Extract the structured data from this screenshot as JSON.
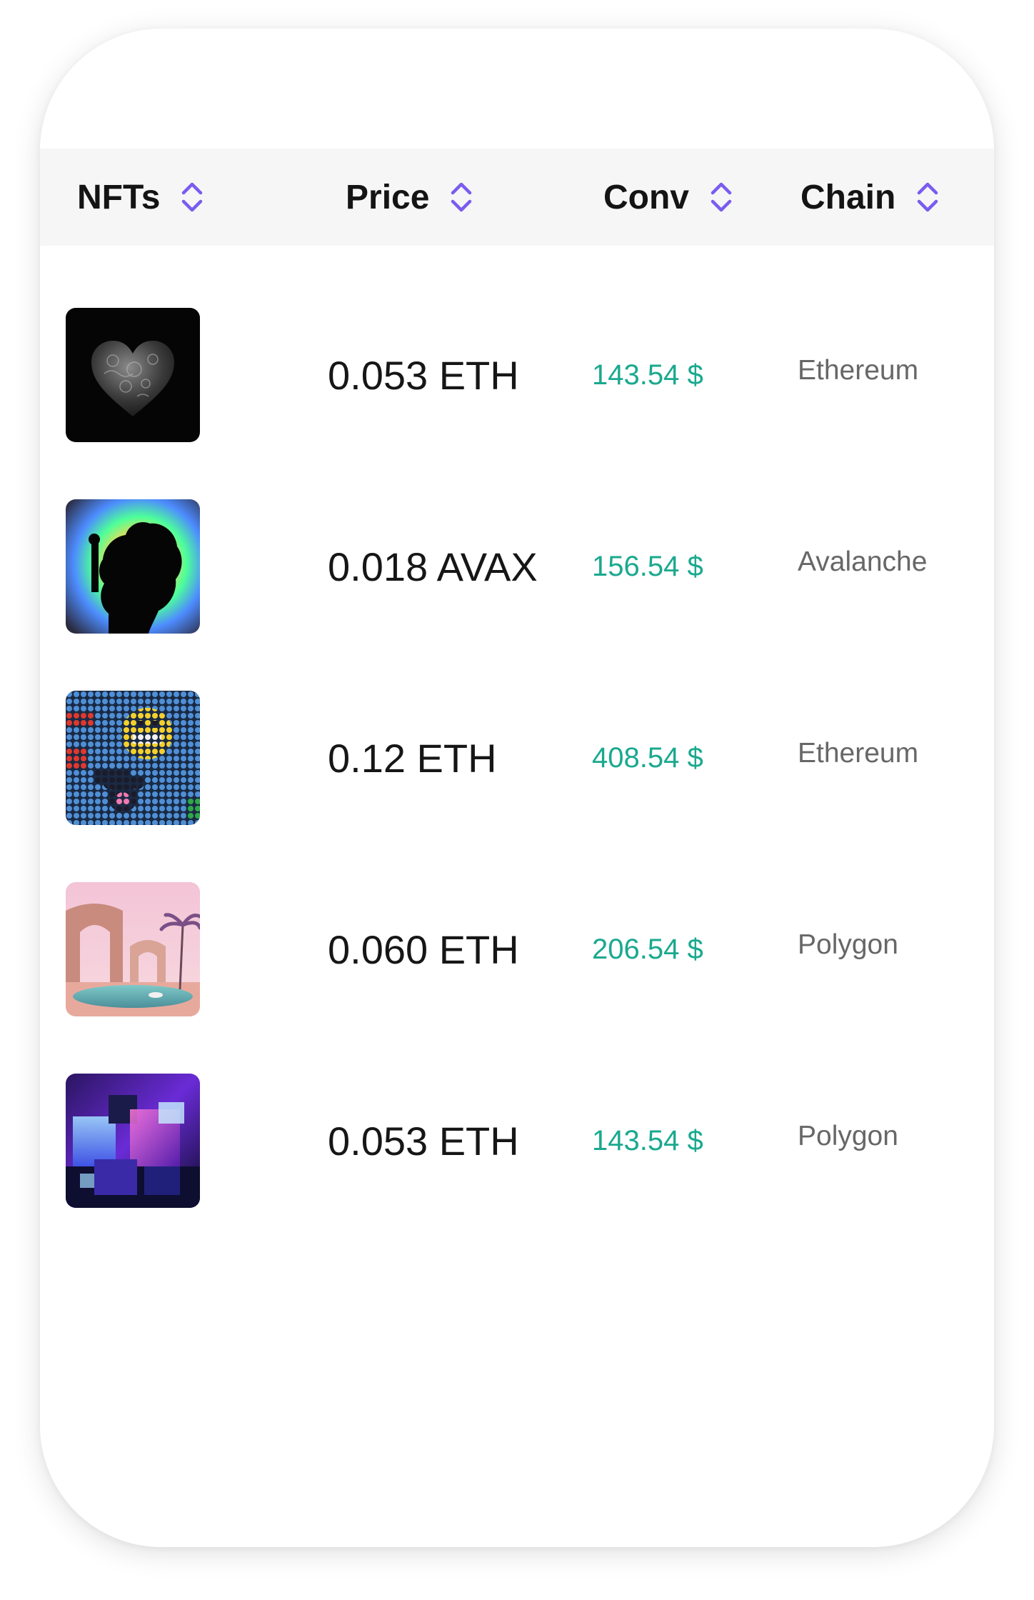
{
  "table": {
    "columns": [
      {
        "label": "NFTs",
        "sort_icon": "sort-updown-icon"
      },
      {
        "label": "Price",
        "sort_icon": "sort-updown-icon"
      },
      {
        "label": "Conv",
        "sort_icon": "sort-updown-icon"
      },
      {
        "label": "Chain",
        "sort_icon": "sort-updown-icon"
      }
    ],
    "rows": [
      {
        "image": "heart-nft-image",
        "price": "0.053 ETH",
        "conv": "143.54 $",
        "chain": "Ethereum"
      },
      {
        "image": "silhouette-nft-image",
        "price": "0.018 AVAX",
        "conv": "156.54 $",
        "chain": "Avalanche"
      },
      {
        "image": "pixel-art-nft-image",
        "price": "0.12 ETH",
        "conv": "408.54 $",
        "chain": "Ethereum"
      },
      {
        "image": "arches-pool-nft-image",
        "price": "0.060 ETH",
        "conv": "206.54 $",
        "chain": "Polygon"
      },
      {
        "image": "neon-cubes-nft-image",
        "price": "0.053 ETH",
        "conv": "143.54 $",
        "chain": "Polygon"
      }
    ]
  },
  "colors": {
    "header_bg": "#f6f6f6",
    "sort_icon": "#7a5cf0",
    "conv_text": "#1aa98f",
    "chain_text": "#676767"
  }
}
